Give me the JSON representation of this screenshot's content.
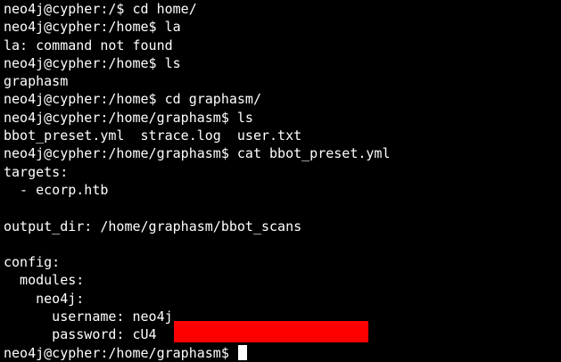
{
  "terminal": {
    "lines": [
      "neo4j@cypher:/$ cd home/",
      "neo4j@cypher:/home$ la",
      "la: command not found",
      "neo4j@cypher:/home$ ls",
      "graphasm",
      "neo4j@cypher:/home$ cd graphasm/",
      "neo4j@cypher:/home/graphasm$ ls",
      "bbot_preset.yml  strace.log  user.txt",
      "neo4j@cypher:/home/graphasm$ cat bbot_preset.yml",
      "targets:",
      "  - ecorp.htb",
      "",
      "output_dir: /home/graphasm/bbot_scans",
      "",
      "config:",
      "  modules:",
      "    neo4j:",
      "      username: neo4j",
      "      password: cU4",
      "neo4j@cypher:/home/graphasm$ "
    ],
    "background_color": "#000000",
    "text_color": "#ffffff",
    "redaction_color": "#ff0000"
  }
}
